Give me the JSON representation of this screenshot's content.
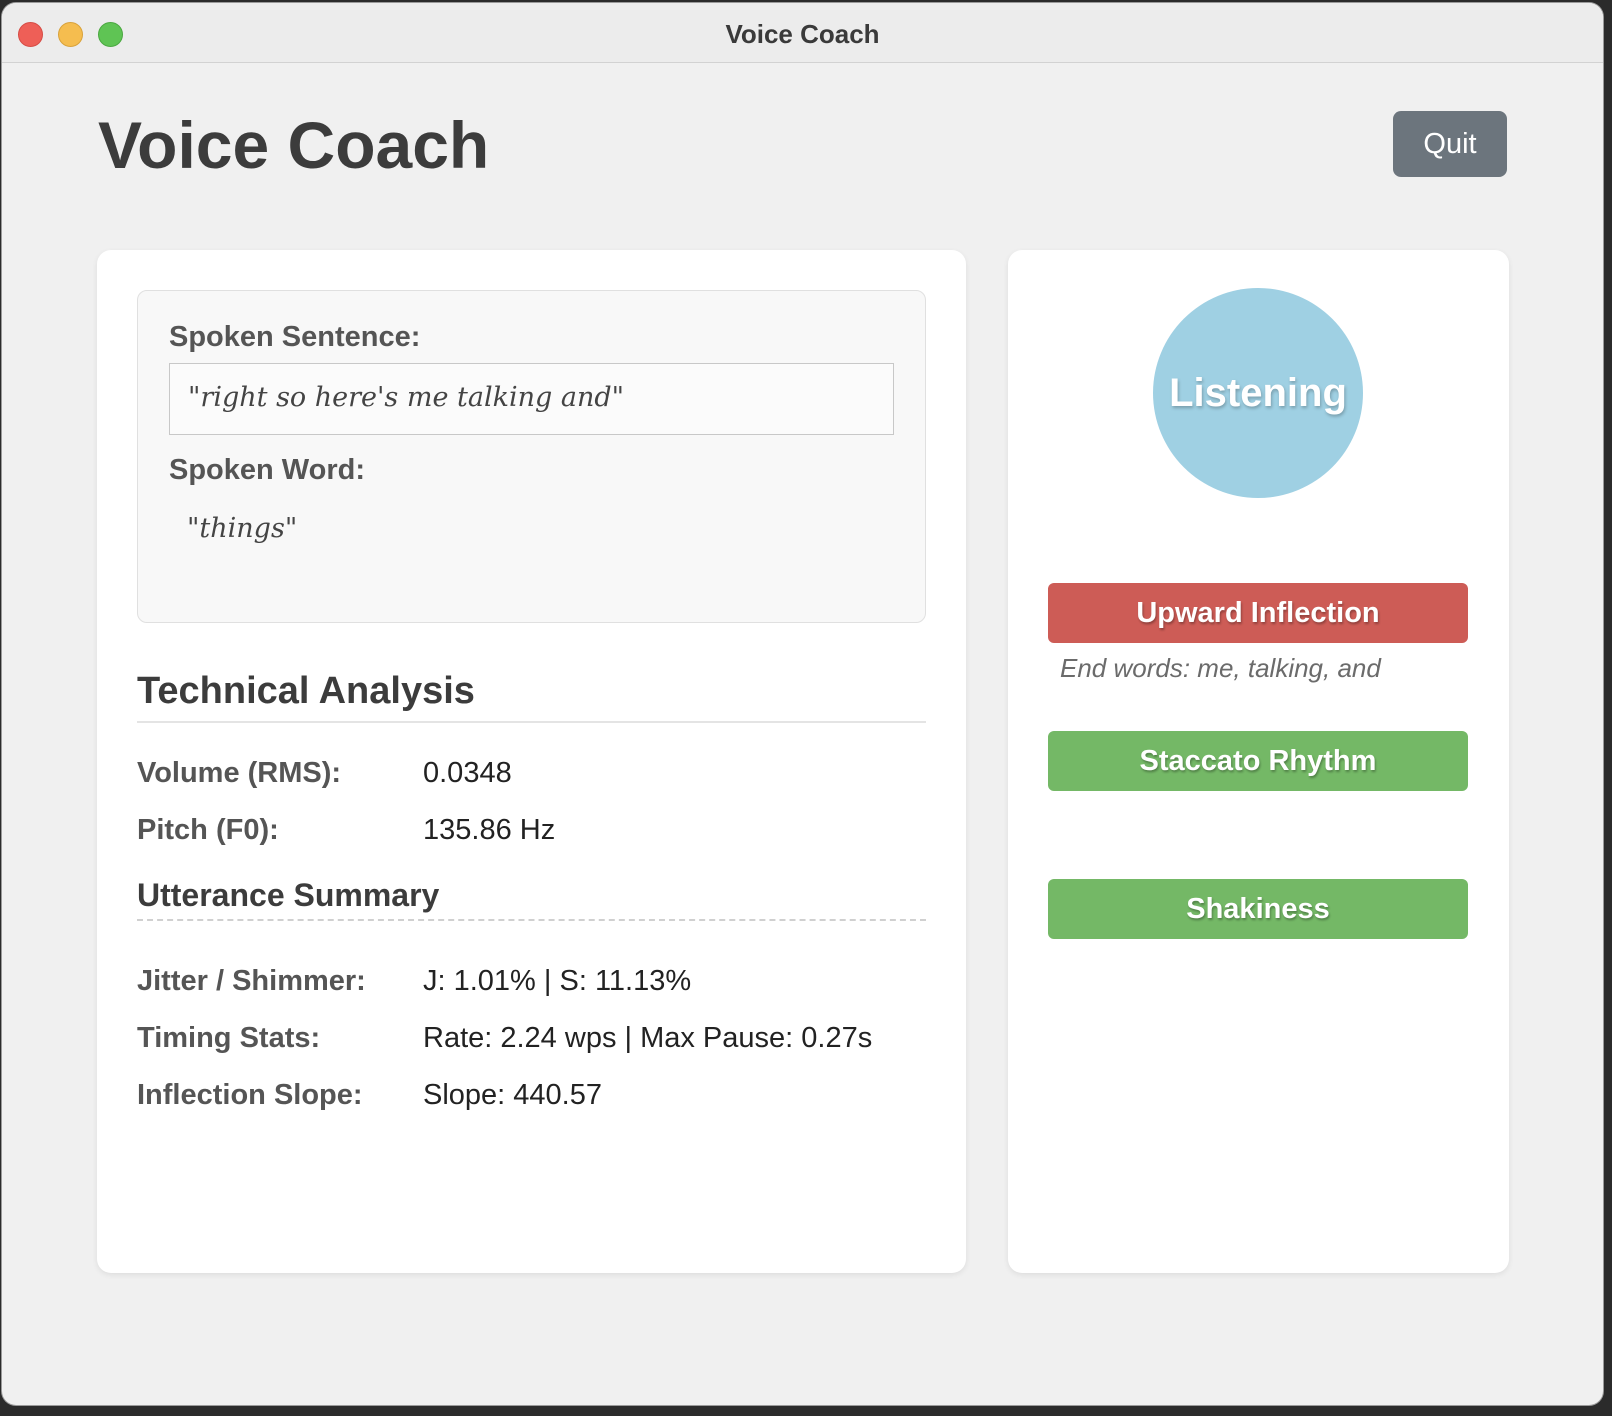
{
  "window": {
    "title": "Voice Coach"
  },
  "header": {
    "title": "Voice Coach",
    "quit_label": "Quit"
  },
  "transcript": {
    "sentence_label": "Spoken Sentence:",
    "sentence_text": "\"right so here's me talking and\"",
    "word_label": "Spoken Word:",
    "word_text": "\"things\""
  },
  "technical_analysis": {
    "heading": "Technical Analysis",
    "metrics": [
      {
        "label": "Volume (RMS):",
        "value": "0.0348"
      },
      {
        "label": "Pitch (F0):",
        "value": "135.86 Hz"
      }
    ]
  },
  "utterance_summary": {
    "heading": "Utterance Summary",
    "metrics": [
      {
        "label": "Jitter / Shimmer:",
        "value": "J: 1.01% | S: 11.13%"
      },
      {
        "label": "Timing Stats:",
        "value": "Rate: 2.24 wps | Max Pause: 0.27s"
      },
      {
        "label": "Inflection Slope:",
        "value": "Slope: 440.57"
      }
    ]
  },
  "status": {
    "label": "Listening",
    "color": "#9fd0e3"
  },
  "indicators": [
    {
      "label": "Upward Inflection",
      "state": "alert",
      "color": "#cd5c56",
      "note": "End words: me, talking, and"
    },
    {
      "label": "Staccato Rhythm",
      "state": "ok",
      "color": "#74b866"
    },
    {
      "label": "Shakiness",
      "state": "ok",
      "color": "#74b866"
    }
  ]
}
